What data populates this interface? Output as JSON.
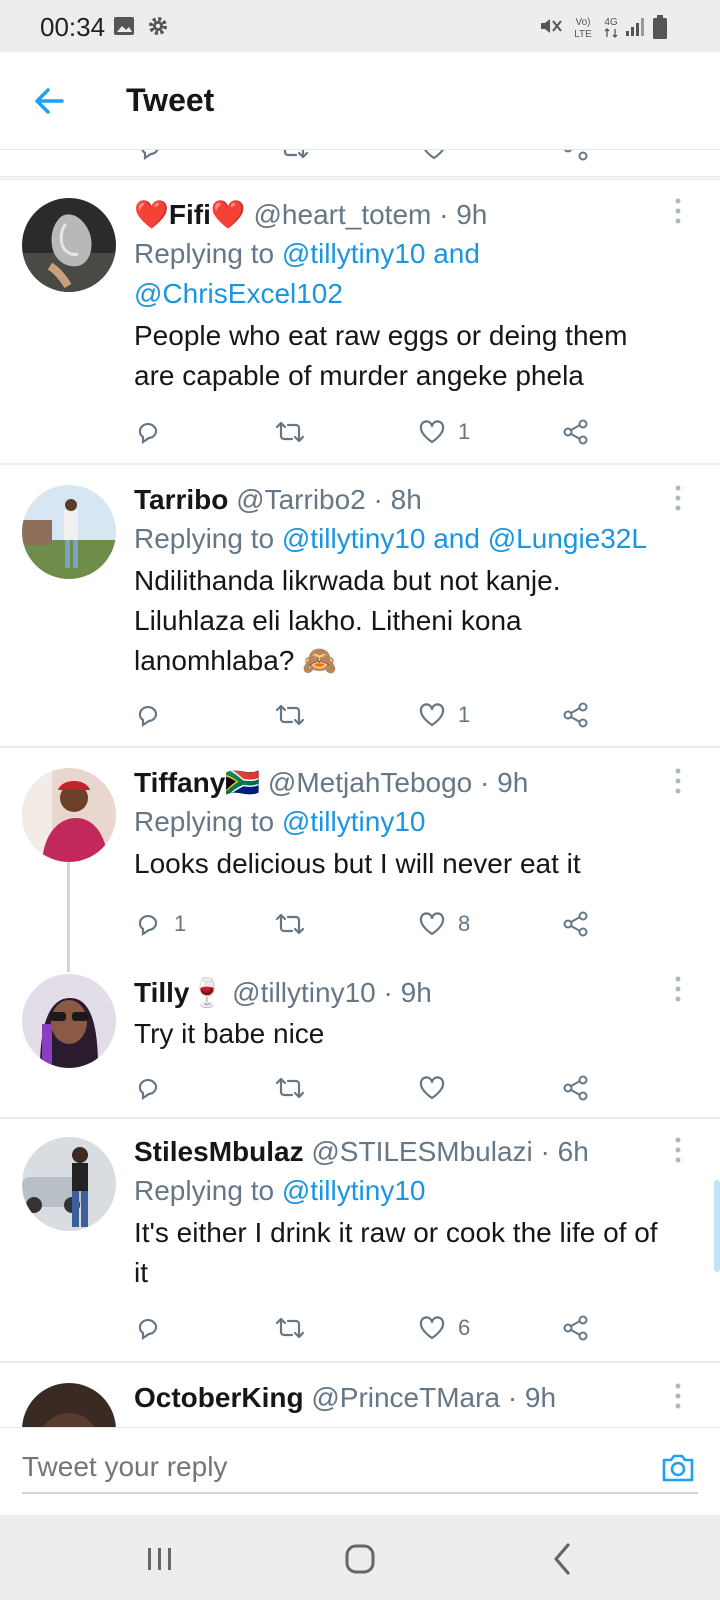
{
  "status_bar": {
    "time": "00:34",
    "network": "4G"
  },
  "header": {
    "title": "Tweet"
  },
  "tweets": [
    {
      "name": "❤️Fifi❤️",
      "handle": "@heart_totem",
      "time": "9h",
      "replying_prefix": "Replying to",
      "mentions": "@tillytiny10 and",
      "mentions_line2": "@ChrisExcel102",
      "text": "People who eat raw eggs or deing them are capable of murder angeke phela",
      "replies": "",
      "retweets": "",
      "likes": "1"
    },
    {
      "name": "Tarribo",
      "handle": "@Tarribo2",
      "time": "8h",
      "replying_prefix": "Replying to",
      "mentions": "@tillytiny10 and @Lungie32L",
      "text": "Ndilithanda likrwada but not kanje. Liluhlaza eli lakho. Litheni kona lanomhlaba? 🙈",
      "replies": "",
      "retweets": "",
      "likes": "1"
    },
    {
      "name": "Tiffany🇿🇦",
      "handle": "@MetjahTebogo",
      "time": "9h",
      "replying_prefix": "Replying to",
      "mentions": "@tillytiny10",
      "text": "Looks delicious but I will never eat it",
      "replies": "1",
      "retweets": "",
      "likes": "8"
    },
    {
      "name": "Tilly🍷",
      "handle": "@tillytiny10",
      "time": "9h",
      "text": "Try it babe nice",
      "replies": "",
      "retweets": "",
      "likes": ""
    },
    {
      "name": "StilesMbulaz",
      "handle": "@STILESMbulazi",
      "time": "6h",
      "replying_prefix": "Replying to",
      "mentions": "@tillytiny10",
      "text": "It's either I drink it raw or cook the life of of it",
      "replies": "",
      "retweets": "",
      "likes": "6"
    },
    {
      "name": "OctoberKing",
      "handle": "@PrinceTMara",
      "time": "9h"
    }
  ],
  "reply_box": {
    "placeholder": "Tweet your reply"
  },
  "separator_dot": "·",
  "colors": {
    "accent": "#1da1f2",
    "link": "#1b95e0",
    "muted": "#657786",
    "text": "#14171a"
  }
}
